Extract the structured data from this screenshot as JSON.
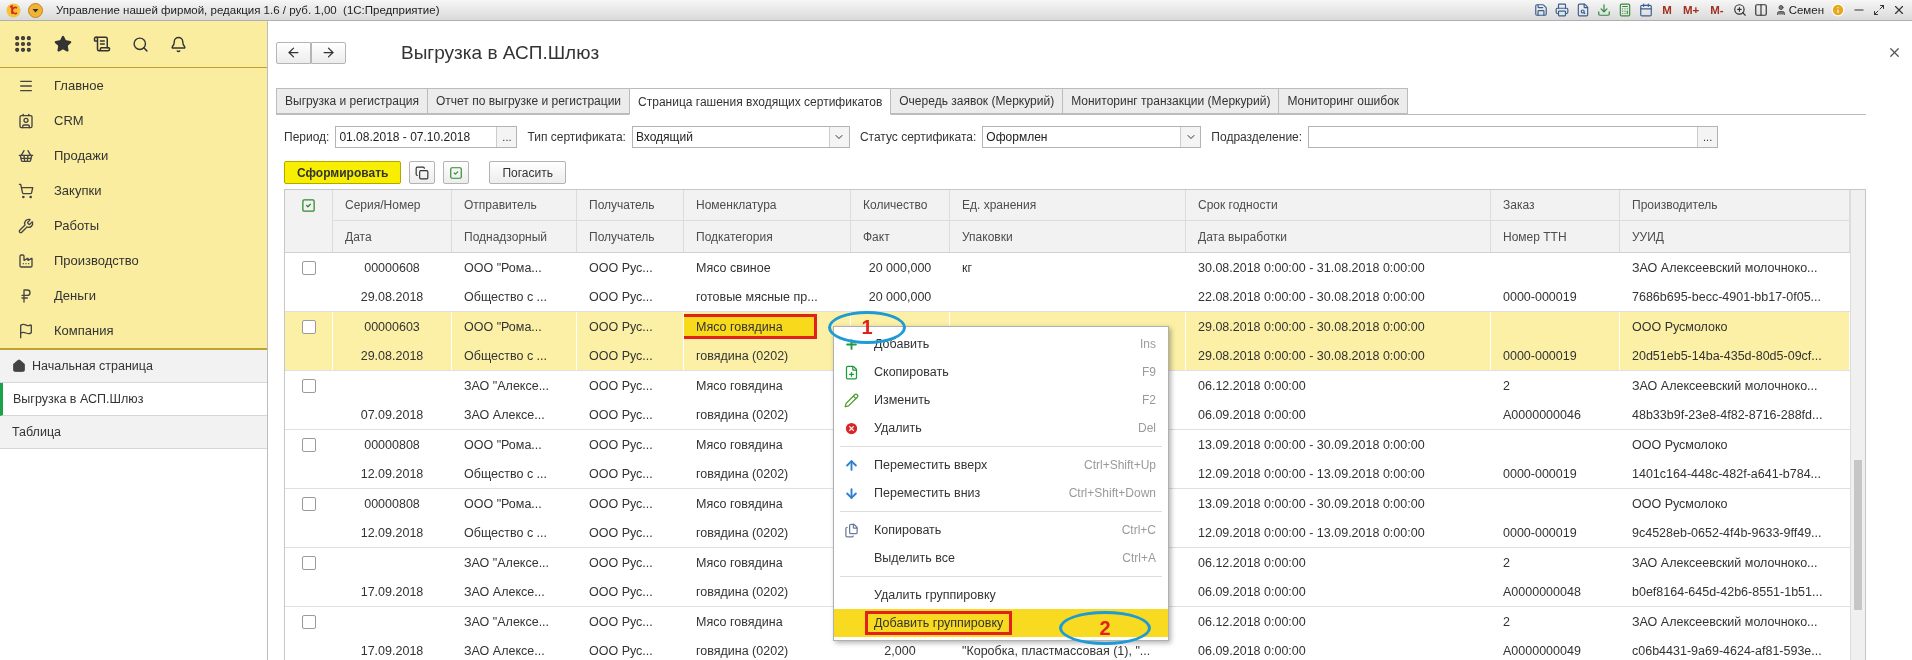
{
  "title_bar": {
    "title": "Управление нашей фирмой, редакция 1.6 / руб. 1,00  (1С:Предприятие)",
    "memory_buttons": [
      "M",
      "M+",
      "M-"
    ],
    "user": "Семен"
  },
  "sidebar": {
    "sections": [
      "Главное",
      "CRM",
      "Продажи",
      "Закупки",
      "Работы",
      "Производство",
      "Деньги",
      "Компания"
    ],
    "open_windows": [
      {
        "label": "Начальная страница",
        "selected": false
      },
      {
        "label": "Выгрузка в АСП.Шлюз",
        "selected": true
      },
      {
        "label": "Таблица",
        "selected": false
      }
    ]
  },
  "form": {
    "title": "Выгрузка в АСП.Шлюз",
    "tabs": [
      {
        "label": "Выгрузка и регистрация",
        "selected": false
      },
      {
        "label": "Отчет по выгрузке и регистрации",
        "selected": false
      },
      {
        "label": "Страница гашения входящих сертификатов",
        "selected": true
      },
      {
        "label": "Очередь заявок (Меркурий)",
        "selected": false
      },
      {
        "label": "Мониторинг транзакции (Меркурий)",
        "selected": false
      },
      {
        "label": "Мониторинг ошибок",
        "selected": false
      }
    ],
    "filters": [
      {
        "label": "Период:",
        "value": "01.08.2018 - 07.10.2018",
        "kind": "choice",
        "choice_button": "..."
      },
      {
        "label": "Тип сертификата:",
        "value": "Входящий",
        "kind": "dropdown"
      },
      {
        "label": "Статус сертификата:",
        "value": "Оформлен",
        "kind": "dropdown"
      },
      {
        "label": "Подразделение:",
        "kind": "choice",
        "choice_button": "..."
      }
    ],
    "buttons": [
      {
        "label": "Сформировать",
        "kind": "primary"
      },
      {
        "kind": "copy"
      },
      {
        "kind": "mark"
      },
      {
        "label": "Погасить",
        "kind": "plain"
      }
    ],
    "table": {
      "header_top": [
        "Серия/Номер",
        "Отправитель",
        "Получатель",
        "Номенклатура",
        "Количество",
        "Ед. хранения",
        "Срок годности",
        "Заказ",
        "Производитель"
      ],
      "header_bottom": [
        "Дата",
        "Поднадзорный",
        "Получатель",
        "Подкатегория",
        "Факт",
        "Упаковки",
        "Дата выработки",
        "Номер ТТН",
        "УУИД"
      ],
      "rows": [
        {
          "checked": false,
          "selected": false,
          "line1": {
            "series_number": "00000608",
            "sender": "ООО \"Рома...",
            "recipient": "ООО Рус...",
            "nomenclature": "Мясо свиное",
            "quantity": "20 000,000",
            "storage_unit": "кг",
            "shelf_life": "30.08.2018 0:00:00 - 31.08.2018 0:00:00",
            "manufacturer": "ЗАО Алексеевский молочноко..."
          },
          "line2": {
            "date": "29.08.2018",
            "supervised": "Общество с ...",
            "recipient": "ООО Рус...",
            "subcategory": "готовые мясные пр...",
            "fact": "20 000,000",
            "production_date": "22.08.2018 0:00:00 - 30.08.2018 0:00:00",
            "ttn_number": "0000-000019",
            "uuid": "7686b695-becc-4901-bb17-0f05..."
          }
        },
        {
          "checked": false,
          "selected": true,
          "line1": {
            "series_number": "00000603",
            "sender": "ООО \"Рома...",
            "recipient": "ООО Рус...",
            "nomenclature": {
              "text": "Мясо говядина",
              "focused": true
            },
            "shelf_life": "29.08.2018 0:00:00 - 30.08.2018 0:00:00",
            "manufacturer": "ООО Русмолоко"
          },
          "line2": {
            "date": "29.08.2018",
            "supervised": "Общество с ...",
            "recipient": "ООО Рус...",
            "subcategory": "говядина (0202)",
            "production_date": "29.08.2018 0:00:00 - 30.08.2018 0:00:00",
            "ttn_number": "0000-000019",
            "uuid": "20d51eb5-14ba-435d-80d5-09cf..."
          }
        },
        {
          "checked": false,
          "selected": false,
          "line1": {
            "sender": "ЗАО \"Алексе...",
            "recipient": "ООО Рус...",
            "nomenclature": "Мясо говядина",
            "shelf_life": "06.12.2018 0:00:00",
            "order": "2",
            "manufacturer": "ЗАО Алексеевский молочноко..."
          },
          "line2": {
            "date": "07.09.2018",
            "supervised": "ЗАО Алексе...",
            "recipient": "ООО Рус...",
            "subcategory": "говядина (0202)",
            "production_date": "06.09.2018 0:00:00",
            "ttn_number": "А0000000046",
            "uuid": "48b33b9f-23e8-4f82-8716-288fd..."
          }
        },
        {
          "checked": false,
          "selected": false,
          "line1": {
            "series_number": "00000808",
            "sender": "ООО \"Рома...",
            "recipient": "ООО Рус...",
            "nomenclature": "Мясо говядина",
            "shelf_life": "13.09.2018 0:00:00 - 30.09.2018 0:00:00",
            "manufacturer": "ООО Русмолоко"
          },
          "line2": {
            "date": "12.09.2018",
            "supervised": "Общество с ...",
            "recipient": "ООО Рус...",
            "subcategory": "говядина (0202)",
            "production_date": "12.09.2018 0:00:00 - 13.09.2018 0:00:00",
            "ttn_number": "0000-000019",
            "uuid": "1401c164-448c-482f-a641-b784..."
          }
        },
        {
          "checked": false,
          "selected": false,
          "line1": {
            "series_number": "00000808",
            "sender": "ООО \"Рома...",
            "recipient": "ООО Рус...",
            "nomenclature": "Мясо говядина",
            "shelf_life": "13.09.2018 0:00:00 - 30.09.2018 0:00:00",
            "manufacturer": "ООО Русмолоко"
          },
          "line2": {
            "date": "12.09.2018",
            "supervised": "Общество с ...",
            "recipient": "ООО Рус...",
            "subcategory": "говядина (0202)",
            "production_date": "12.09.2018 0:00:00 - 13.09.2018 0:00:00",
            "ttn_number": "0000-000019",
            "uuid": "9c4528eb-0652-4f4b-9633-9ff49..."
          }
        },
        {
          "checked": false,
          "selected": false,
          "line1": {
            "sender": "ЗАО \"Алексе...",
            "recipient": "ООО Рус...",
            "nomenclature": "Мясо говядина",
            "shelf_life": "06.12.2018 0:00:00",
            "order": "2",
            "manufacturer": "ЗАО Алексеевский молочноко..."
          },
          "line2": {
            "date": "17.09.2018",
            "supervised": "ЗАО Алексе...",
            "recipient": "ООО Рус...",
            "subcategory": "говядина (0202)",
            "production_date": "06.09.2018 0:00:00",
            "ttn_number": "А0000000048",
            "uuid": "b0ef8164-645d-42b6-8551-1b51..."
          }
        },
        {
          "checked": false,
          "selected": false,
          "line1": {
            "sender": "ЗАО \"Алексе...",
            "recipient": "ООО Рус...",
            "nomenclature": "Мясо говядина",
            "shelf_life": "06.12.2018 0:00:00",
            "order": "2",
            "manufacturer": "ЗАО Алексеевский молочноко..."
          },
          "line2": {
            "date": "17.09.2018",
            "supervised": "ЗАО Алексе...",
            "recipient": "ООО Рус...",
            "subcategory": "говядина (0202)",
            "fact": "2,000",
            "packaging": "\"Коробка, пластмассовая (1), \"...",
            "production_date": "06.09.2018 0:00:00",
            "ttn_number": "А0000000049",
            "uuid": "c06b4431-9a69-4624-af81-593e..."
          }
        }
      ]
    },
    "context_menu": {
      "items": [
        {
          "kind": "add",
          "label": "Добавить",
          "shortcut": "Ins",
          "selected": false
        },
        {
          "kind": "duplicate",
          "label": "Скопировать",
          "shortcut": "F9",
          "selected": false
        },
        {
          "kind": "edit",
          "label": "Изменить",
          "shortcut": "F2",
          "selected": false
        },
        {
          "kind": "delete",
          "label": "Удалить",
          "shortcut": "Del",
          "selected": false
        },
        {
          "kind": "separator"
        },
        {
          "kind": "up",
          "label": "Переместить вверх",
          "shortcut": "Ctrl+Shift+Up",
          "selected": false
        },
        {
          "kind": "down",
          "label": "Переместить вниз",
          "shortcut": "Ctrl+Shift+Down",
          "selected": false
        },
        {
          "kind": "separator"
        },
        {
          "kind": "copy",
          "label": "Копировать",
          "shortcut": "Ctrl+C",
          "selected": false
        },
        {
          "kind": "plain",
          "label": "Выделить все",
          "shortcut": "Ctrl+A",
          "selected": false
        },
        {
          "kind": "separator"
        },
        {
          "kind": "plain",
          "label": "Удалить группировку",
          "selected": false
        },
        {
          "kind": "plain",
          "label": "Добавить группировку",
          "selected": true
        }
      ]
    },
    "annotations": [
      {
        "label": "1"
      },
      {
        "label": "2"
      }
    ]
  }
}
